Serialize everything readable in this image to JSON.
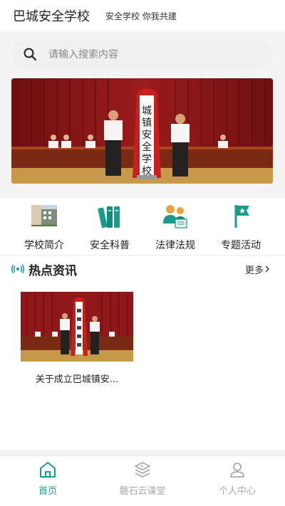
{
  "header": {
    "title": "巴城安全学校",
    "slogan": "安全学校 你我共建"
  },
  "search": {
    "placeholder": "请输入搜索内容"
  },
  "banner": {
    "sign_text": "城镇安全学校"
  },
  "quick_nav": [
    {
      "label": "学校简介",
      "icon": "school-building-icon"
    },
    {
      "label": "安全科普",
      "icon": "books-icon"
    },
    {
      "label": "法律法规",
      "icon": "law-people-icon"
    },
    {
      "label": "专题活动",
      "icon": "flag-icon"
    }
  ],
  "news": {
    "title": "热点资讯",
    "more_label": "更多",
    "items": [
      {
        "title": "关于成立巴城镇安..."
      }
    ]
  },
  "tabs": [
    {
      "label": "首页",
      "icon": "home-icon",
      "active": true
    },
    {
      "label": "磐石云课堂",
      "icon": "classroom-icon",
      "active": false
    },
    {
      "label": "个人中心",
      "icon": "user-icon",
      "active": false
    }
  ],
  "colors": {
    "accent": "#1b9b8e",
    "curtain": "#8e1717",
    "banner_red": "#c81e1e"
  }
}
